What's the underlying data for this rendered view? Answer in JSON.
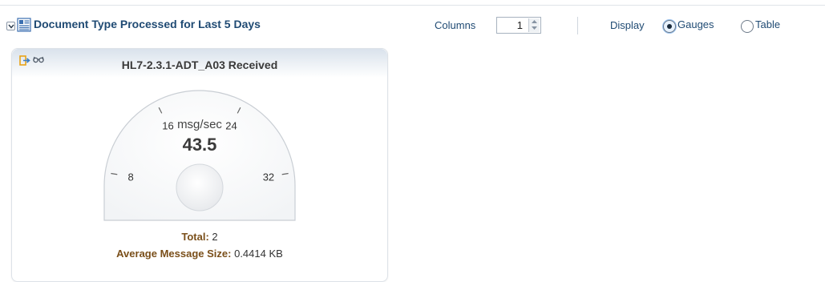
{
  "header": {
    "title": "Document Type Processed for Last 5 Days",
    "columns_label": "Columns",
    "columns_value": "1",
    "display_label": "Display",
    "display_options": [
      {
        "label": "Gauges",
        "selected": true
      },
      {
        "label": "Table",
        "selected": false
      }
    ]
  },
  "card": {
    "title": "HL7-2.3.1-ADT_A03 Received",
    "gauge": {
      "unit": "msg/sec",
      "value_text": "43.5",
      "value": 43.5,
      "min": 0,
      "max": 40,
      "ticks": [
        "0",
        "8",
        "16",
        "24",
        "32",
        "40"
      ]
    },
    "total_label": "Total:",
    "total_value": "2",
    "avg_label": "Average Message Size:",
    "avg_value": "0.4414",
    "avg_unit": "KB"
  },
  "colors": {
    "header_text": "#1f4a73",
    "card_label": "#7a4f1a",
    "export_icon": "#e8a317"
  },
  "icons": {
    "collapse": "chevron-down-icon",
    "document": "document-type-icon",
    "export": "export-icon",
    "view": "glasses-icon"
  }
}
